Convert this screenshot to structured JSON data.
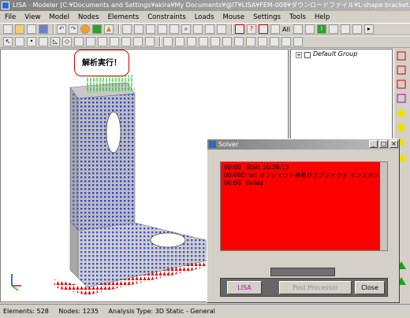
{
  "window": {
    "title": "LISA - Modeler [C:¥Documents and Settings¥akira¥My Documents¥@IT¥LISA¥FEM-008¥ダウンロードファイル¥L-shape bracket.liml]"
  },
  "menu": [
    "File",
    "View",
    "Model",
    "Nodes",
    "Elements",
    "Constraints",
    "Loads",
    "Mouse",
    "Settings",
    "Tools",
    "Help"
  ],
  "toolbar": {
    "all_label": "All"
  },
  "callout": {
    "text": "解析実行！"
  },
  "tree": {
    "group_label": "Default Group",
    "expander": "+"
  },
  "status": {
    "elements": "Elements: 528",
    "nodes": "Nodes: 1235",
    "analysis": "Analysis Type: 3D Static - General"
  },
  "solver": {
    "title": "Solver",
    "log": [
      {
        "time": "00:00",
        "msg": "Start 10:38:13"
      },
      {
        "time": "00:00",
        "msg": "Error: オブジェクト参照がオブジェクト インスタンスに設定されていません。"
      },
      {
        "time": "00:00",
        "msg": "Failed"
      }
    ],
    "lisa_label": "LISA",
    "post_label": "Post Processor",
    "close_label": "Close"
  },
  "colors": {
    "log_bg": "#ff0000",
    "mesh": "#c8c8c8",
    "node": "#1a2fd0",
    "support": "#e00000",
    "load": "#20c020"
  }
}
